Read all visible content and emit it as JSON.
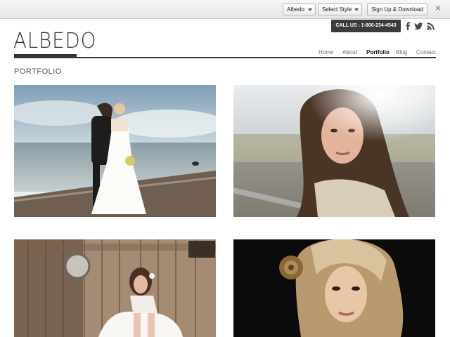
{
  "topbar": {
    "theme_select": "Albedo",
    "style_select": "Select Style",
    "signup_label": "Sign Up & Download",
    "close_glyph": "✕"
  },
  "header": {
    "logo": "ALBEDO",
    "call_us": "CALL US : 1-800-234-4543",
    "social": [
      {
        "icon": "facebook-icon",
        "glyph": "f"
      },
      {
        "icon": "twitter-icon",
        "glyph": "t"
      },
      {
        "icon": "rss-icon",
        "glyph": "rss"
      }
    ]
  },
  "nav": {
    "items": [
      {
        "label": "Home",
        "active": false
      },
      {
        "label": "About",
        "active": false
      },
      {
        "label": "Portfolio",
        "active": true
      },
      {
        "label": "Blog",
        "active": false
      },
      {
        "label": "Contact",
        "active": false
      }
    ]
  },
  "page": {
    "section_title": "PORTFOLIO"
  },
  "portfolio": {
    "items": [
      {
        "subject": "wedding couple on beach"
      },
      {
        "subject": "woman portrait in sunlight"
      },
      {
        "subject": "bride sitting by wooden barn"
      },
      {
        "subject": "blonde woman with flower on black"
      }
    ]
  },
  "colors": {
    "text_dark": "#333333",
    "callus_bg": "#3b3b3b",
    "topbar_bg": "#ececec"
  }
}
